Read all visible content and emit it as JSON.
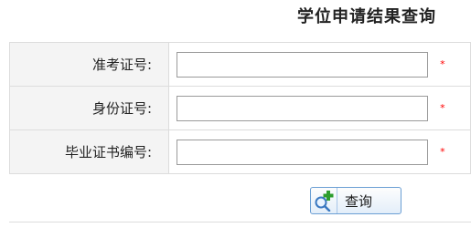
{
  "title": "学位申请结果查询",
  "form": {
    "fields": [
      {
        "label": "准考证号:",
        "value": "",
        "required_mark": "*"
      },
      {
        "label": "身份证号:",
        "value": "",
        "required_mark": "*"
      },
      {
        "label": "毕业证书编号:",
        "value": "",
        "required_mark": "*"
      }
    ]
  },
  "query_button": {
    "label": "查询",
    "icon": "search-add-icon"
  },
  "colors": {
    "required": "#ff0000",
    "button_border": "#6b9fd4",
    "label_background": "#f4f4f4"
  }
}
